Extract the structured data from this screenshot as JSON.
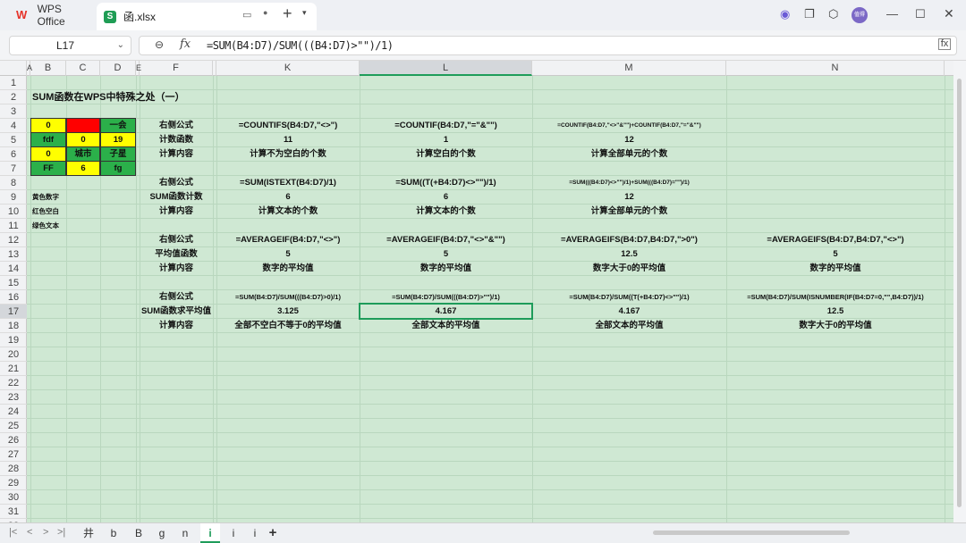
{
  "titlebar": {
    "app_tab": "WPS Office",
    "file_tab": "函.xlsx",
    "new_tab": "+",
    "avatar_text": "值得"
  },
  "formula_bar": {
    "cell_ref": "L17",
    "fx": "fx",
    "formula": "=SUM(B4:D7)/SUM(((B4:D7)>\"\")/1)"
  },
  "columns": [
    "A",
    "B",
    "C",
    "D",
    "E",
    "F",
    "",
    "K",
    "L",
    "M",
    "N"
  ],
  "rows": [
    "1",
    "2",
    "3",
    "4",
    "5",
    "6",
    "7",
    "8",
    "9",
    "10",
    "11",
    "12",
    "13",
    "14",
    "15",
    "16",
    "17",
    "18",
    "19",
    "20",
    "21",
    "22",
    "23",
    "24",
    "25",
    "26",
    "27",
    "28",
    "29",
    "30",
    "31",
    "32"
  ],
  "title": "SUM函数在WPS中特殊之处（一）",
  "data_table": [
    [
      "0",
      "",
      "一会"
    ],
    [
      "fdf",
      "0",
      "19"
    ],
    [
      "0",
      "城市",
      "子星"
    ],
    [
      "FF",
      "6",
      "fg"
    ]
  ],
  "legend": [
    "黄色数字",
    "红色空白",
    "绿色文本"
  ],
  "blocks": [
    {
      "labels": [
        "右侧公式",
        "计数函数",
        "计算内容"
      ],
      "formulas": [
        "=COUNTIFS(B4:D7,\"<>\")",
        "=COUNTIF(B4:D7,\"=\"&\"\")",
        "=COUNTIF(B4:D7,\"<>\"&\"\")+COUNTIF(B4:D7,\"=\"&\"\")",
        ""
      ],
      "values": [
        "11",
        "1",
        "12",
        ""
      ],
      "desc": [
        "计算不为空白的个数",
        "计算空白的个数",
        "计算全部单元的个数",
        ""
      ]
    },
    {
      "labels": [
        "右侧公式",
        "SUM函数计数",
        "计算内容"
      ],
      "formulas": [
        "=SUM(ISTEXT(B4:D7)/1)",
        "=SUM((T(+B4:D7)<>\"\")/1)",
        "=SUM(((B4:D7)<>\"\")/1)+SUM(((B4:D7)=\"\")/1)",
        ""
      ],
      "values": [
        "6",
        "6",
        "12",
        ""
      ],
      "desc": [
        "计算文本的个数",
        "计算文本的个数",
        "计算全部单元的个数",
        ""
      ]
    },
    {
      "labels": [
        "右侧公式",
        "平均值函数",
        "计算内容"
      ],
      "formulas": [
        "=AVERAGEIF(B4:D7,\"<>\")",
        "=AVERAGEIF(B4:D7,\"<>\"&\"\")",
        "=AVERAGEIFS(B4:D7,B4:D7,\">0\")",
        "=AVERAGEIFS(B4:D7,B4:D7,\"<>\")"
      ],
      "values": [
        "5",
        "5",
        "12.5",
        "5"
      ],
      "desc": [
        "数字的平均值",
        "数字的平均值",
        "数字大于0的平均值",
        "数字的平均值"
      ]
    },
    {
      "labels": [
        "右侧公式",
        "SUM函数求平均值",
        "计算内容"
      ],
      "formulas": [
        "=SUM(B4:D7)/SUM(((B4:D7)>0)/1)",
        "=SUM(B4:D7)/SUM(((B4:D7)>\"\")/1)",
        "=SUM(B4:D7)/SUM((T(+B4:D7)<>\"\")/1)",
        "=SUM(B4:D7)/SUM(ISNUMBER(IF(B4:D7=0,\"\",B4:D7))/1)"
      ],
      "values": [
        "3.125",
        "4.167",
        "4.167",
        "12.5"
      ],
      "desc": [
        "全部不空白不等于0的平均值",
        "全部文本的平均值",
        "全部文本的平均值",
        "数字大于0的平均值"
      ]
    }
  ],
  "sheet_tabs": [
    "井",
    "b",
    "B",
    "g",
    "n",
    "i",
    "i",
    "i"
  ],
  "active_sheet_index": 5,
  "add_sheet": "+",
  "colors": {
    "yellow": "#ffff00",
    "red": "#ff0000",
    "green": "#2bb04a",
    "accent": "#1e9c5a",
    "sheet_bg": "#cfe8d3"
  }
}
